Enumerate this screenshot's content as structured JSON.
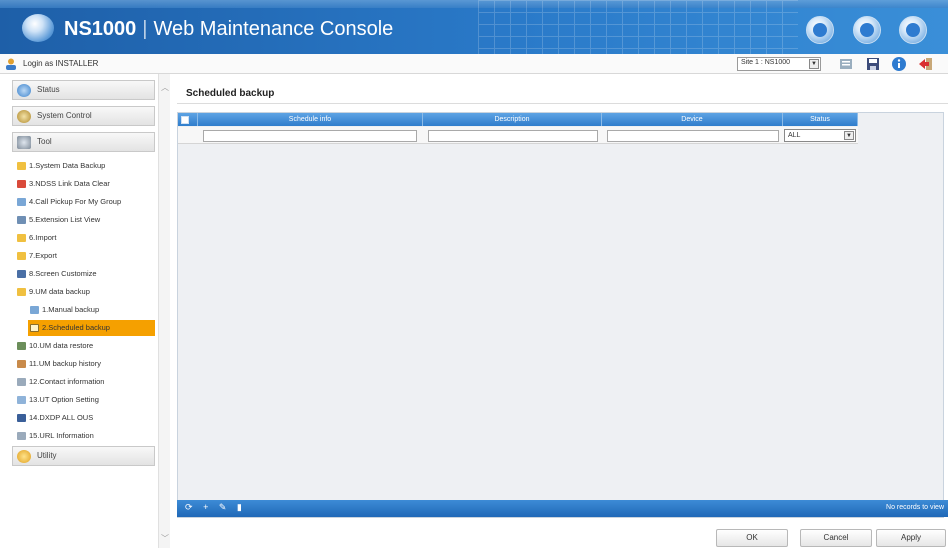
{
  "header": {
    "product": "NS1000",
    "separator": "|",
    "title": "Web Maintenance Console",
    "colors": {
      "bar": "#2a7ac9",
      "accent": "#f5a000"
    },
    "buttons": [
      {
        "icon": "home-icon"
      },
      {
        "icon": "tools-icon"
      },
      {
        "icon": "help-icon"
      }
    ]
  },
  "loginbar": {
    "login_text": "Login as INSTALLER",
    "site_select": "Site 1 : NS1000",
    "icons": [
      "user-list-icon",
      "save-icon",
      "info-icon",
      "logout-icon"
    ]
  },
  "sidebar": {
    "headers": {
      "status": "Status",
      "system_control": "System Control",
      "tool": "Tool",
      "utility": "Utility"
    },
    "items": [
      {
        "label": "1.System Data Backup"
      },
      {
        "label": "3.NDSS Link Data Clear"
      },
      {
        "label": "4.Call Pickup For My Group"
      },
      {
        "label": "5.Extension List View"
      },
      {
        "label": "6.Import"
      },
      {
        "label": "7.Export"
      },
      {
        "label": "8.Screen Customize"
      },
      {
        "label": "9.UM data backup"
      },
      {
        "label": "1.Manual backup"
      },
      {
        "label": "2.Scheduled backup"
      },
      {
        "label": "10.UM data restore"
      },
      {
        "label": "11.UM backup history"
      },
      {
        "label": "12.Contact information"
      },
      {
        "label": "13.UT Option Setting"
      },
      {
        "label": "14.DXDP ALL OUS"
      },
      {
        "label": "15.URL Information"
      }
    ]
  },
  "main": {
    "title": "Scheduled backup",
    "columns": [
      "Schedule info",
      "Description",
      "Device",
      "Status"
    ],
    "status_filter": "ALL",
    "no_records": "No records to view",
    "buttons": {
      "ok": "OK",
      "cancel": "Cancel",
      "apply": "Apply"
    }
  }
}
